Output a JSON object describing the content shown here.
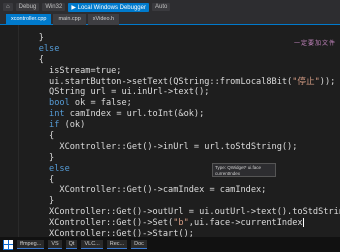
{
  "titlebar": {
    "items": [
      "⌂",
      "Debug",
      "Win32",
      "▶ Local Windows Debugger",
      "Auto"
    ]
  },
  "tabs": [
    "xcontroller.cpp",
    "main.cpp",
    "xVideo.h"
  ],
  "annotation": "一定要加文件",
  "tooltip": {
    "title": "Type: QWidget* ui.face",
    "desc": "currentIndex"
  },
  "code_lines": [
    {
      "indent": 2,
      "segments": [
        {
          "t": "}",
          "c": ""
        }
      ]
    },
    {
      "indent": 2,
      "segments": [
        {
          "t": "else",
          "c": "kw"
        }
      ]
    },
    {
      "indent": 2,
      "segments": [
        {
          "t": "{",
          "c": ""
        }
      ]
    },
    {
      "indent": 3,
      "segments": [
        {
          "t": "isStream=true;",
          "c": ""
        }
      ]
    },
    {
      "indent": 3,
      "segments": [
        {
          "t": "ui.startButton->setText(QString::fromLocal8Bit(",
          "c": ""
        },
        {
          "t": "\"停止\"",
          "c": "str"
        },
        {
          "t": "));",
          "c": ""
        }
      ]
    },
    {
      "indent": 3,
      "segments": [
        {
          "t": "QString url = ui.inUrl->text();",
          "c": ""
        }
      ]
    },
    {
      "indent": 3,
      "segments": [
        {
          "t": "bool",
          "c": "kw"
        },
        {
          "t": " ok = false;",
          "c": ""
        }
      ]
    },
    {
      "indent": 3,
      "segments": [
        {
          "t": "int",
          "c": "kw"
        },
        {
          "t": " camIndex = url.toInt(&ok);",
          "c": ""
        }
      ]
    },
    {
      "indent": 3,
      "segments": [
        {
          "t": "if",
          "c": "kw"
        },
        {
          "t": " (ok)",
          "c": ""
        }
      ]
    },
    {
      "indent": 3,
      "segments": [
        {
          "t": "{",
          "c": ""
        }
      ]
    },
    {
      "indent": 4,
      "segments": [
        {
          "t": "XController::Get()->inUrl = url.toStdString();",
          "c": ""
        }
      ]
    },
    {
      "indent": 3,
      "segments": [
        {
          "t": "}",
          "c": ""
        }
      ]
    },
    {
      "indent": 3,
      "segments": [
        {
          "t": "else",
          "c": "kw"
        }
      ]
    },
    {
      "indent": 3,
      "segments": [
        {
          "t": "{",
          "c": ""
        }
      ]
    },
    {
      "indent": 4,
      "segments": [
        {
          "t": "XController::Get()->camIndex = camIndex;",
          "c": ""
        }
      ]
    },
    {
      "indent": 3,
      "segments": [
        {
          "t": "}",
          "c": ""
        }
      ]
    },
    {
      "indent": 3,
      "segments": [
        {
          "t": "XController::Get()->outUrl = ui.outUrl->text().toStdString();",
          "c": ""
        }
      ]
    },
    {
      "indent": 3,
      "segments": [
        {
          "t": "XController::Get()->Set(",
          "c": ""
        },
        {
          "t": "\"b\"",
          "c": "str"
        },
        {
          "t": ",ui.face->currentIndex",
          "c": ""
        }
      ]
    },
    {
      "indent": 3,
      "segments": [
        {
          "t": "XController::Get()->Start();",
          "c": ""
        }
      ]
    },
    {
      "indent": 2,
      "segments": [
        {
          "t": "}",
          "c": ""
        }
      ]
    }
  ],
  "taskbar": [
    "ffmpeg...",
    "VS",
    "Qt",
    "VLC...",
    "Rec...",
    "Doc"
  ]
}
